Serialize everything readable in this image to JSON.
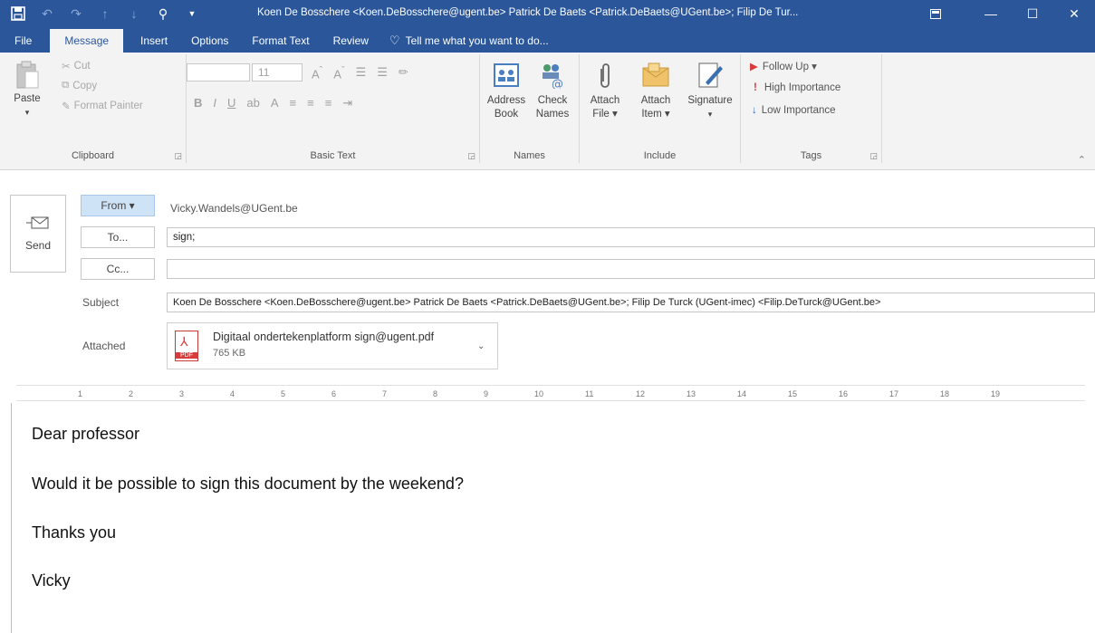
{
  "window": {
    "title": "Koen De Bosschere <Koen.DeBosschere@ugent.be> Patrick De Baets <Patrick.DeBaets@UGent.be>; Filip De Tur...",
    "accent_color": "#2b579a"
  },
  "tabs": [
    "File",
    "Message",
    "Insert",
    "Options",
    "Format Text",
    "Review"
  ],
  "active_tab": "Message",
  "tell_me": "Tell me what you want to do...",
  "ribbon": {
    "clipboard": {
      "paste": "Paste",
      "cut": "Cut",
      "copy": "Copy",
      "format_painter": "Format Painter",
      "label": "Clipboard"
    },
    "basic_text": {
      "font_size": "11",
      "label": "Basic Text"
    },
    "names": {
      "address_book_1": "Address",
      "address_book_2": "Book",
      "check_names_1": "Check",
      "check_names_2": "Names",
      "label": "Names"
    },
    "include": {
      "attach_file_1": "Attach",
      "attach_file_2": "File ▾",
      "attach_item_1": "Attach",
      "attach_item_2": "Item ▾",
      "signature": "Signature",
      "signature_dd": "▾",
      "label": "Include"
    },
    "tags": {
      "follow_up": "Follow Up ▾",
      "high": "High Importance",
      "low": "Low Importance",
      "label": "Tags"
    }
  },
  "compose": {
    "send": "Send",
    "from_button": "From ▾",
    "from_value": "Vicky.Wandels@UGent.be",
    "to_button": "To...",
    "to_value": "sign;",
    "cc_button": "Cc...",
    "cc_value": "",
    "subject_label": "Subject",
    "subject_value": "Koen De Bosschere <Koen.DeBosschere@ugent.be> Patrick De Baets <Patrick.DeBaets@UGent.be>; Filip De Turck (UGent-imec) <Filip.DeTurck@UGent.be>",
    "attached_label": "Attached",
    "attachment": {
      "name": "Digitaal ondertekenplatform sign@ugent.pdf",
      "size": "765 KB"
    }
  },
  "ruler": [
    "1",
    "2",
    "3",
    "4",
    "5",
    "6",
    "7",
    "8",
    "9",
    "10",
    "11",
    "12",
    "13",
    "14",
    "15",
    "16",
    "17",
    "18",
    "19"
  ],
  "body": {
    "line1": "Dear professor",
    "line2": "Would it be possible to sign this document by the weekend?",
    "line3": "Thanks you",
    "line4": "Vicky"
  }
}
